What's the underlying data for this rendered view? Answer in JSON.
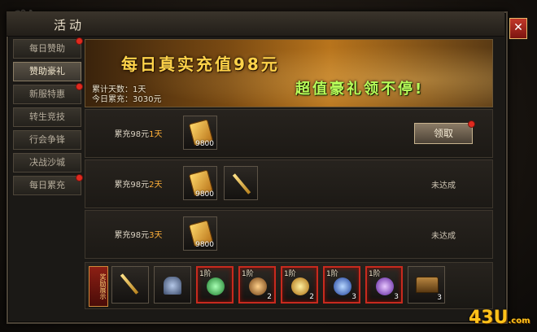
{
  "window": {
    "title": "活动",
    "close_label": "✕"
  },
  "sidebar": {
    "items": [
      {
        "label": "每日赞助",
        "badge": true,
        "active": false
      },
      {
        "label": "赞助豪礼",
        "badge": false,
        "active": true
      },
      {
        "label": "新服特惠",
        "badge": true,
        "active": false
      },
      {
        "label": "转生竞技",
        "badge": false,
        "active": false
      },
      {
        "label": "行会争锋",
        "badge": false,
        "active": false
      },
      {
        "label": "决战沙城",
        "badge": false,
        "active": false
      },
      {
        "label": "每日累充",
        "badge": true,
        "active": false
      }
    ]
  },
  "banner": {
    "headline": "每日真实充值98元",
    "subline": "超值豪礼领不停!",
    "accumulated_days": "累计天数：1天",
    "today_recharge": "今日累充：3030元"
  },
  "rows": [
    {
      "label_prefix": "累充98元",
      "day": "1天",
      "items": [
        {
          "icon": "scroll-icon",
          "count": "9800"
        }
      ],
      "action": "领取",
      "action_badge": true,
      "status": ""
    },
    {
      "label_prefix": "累充98元",
      "day": "2天",
      "items": [
        {
          "icon": "scroll-icon",
          "count": "9800"
        },
        {
          "icon": "sword-icon",
          "count": ""
        }
      ],
      "action": "",
      "status": "未达成"
    },
    {
      "label_prefix": "累充98元",
      "day": "3天",
      "items": [
        {
          "icon": "scroll-icon",
          "count": "9800"
        }
      ],
      "action": "",
      "status": "未达成"
    }
  ],
  "reward_bar": {
    "label": "奖励展示",
    "slots": [
      {
        "icon": "sword-icon",
        "tag": "",
        "count": "",
        "highlight": false
      },
      {
        "icon": "armor-figure-icon",
        "tag": "",
        "count": "",
        "highlight": false
      },
      {
        "icon": "green-gem-icon",
        "tag": "1阶",
        "count": "",
        "highlight": true,
        "color": "#3fd35a"
      },
      {
        "icon": "bronze-mask-icon",
        "tag": "1阶",
        "count": "2",
        "highlight": true,
        "color": "#c98a3a"
      },
      {
        "icon": "gold-ring-icon",
        "tag": "1阶",
        "count": "2",
        "highlight": true,
        "color": "#e0a12a"
      },
      {
        "icon": "blue-crystal-icon",
        "tag": "1阶",
        "count": "3",
        "highlight": true,
        "color": "#4a8cff"
      },
      {
        "icon": "purple-crystal-icon",
        "tag": "1阶",
        "count": "3",
        "highlight": true,
        "color": "#a85bff"
      },
      {
        "icon": "treasure-chest-icon",
        "tag": "",
        "count": "3",
        "highlight": false
      }
    ]
  },
  "watermark": {
    "text": "43U",
    "suffix": ".com"
  }
}
